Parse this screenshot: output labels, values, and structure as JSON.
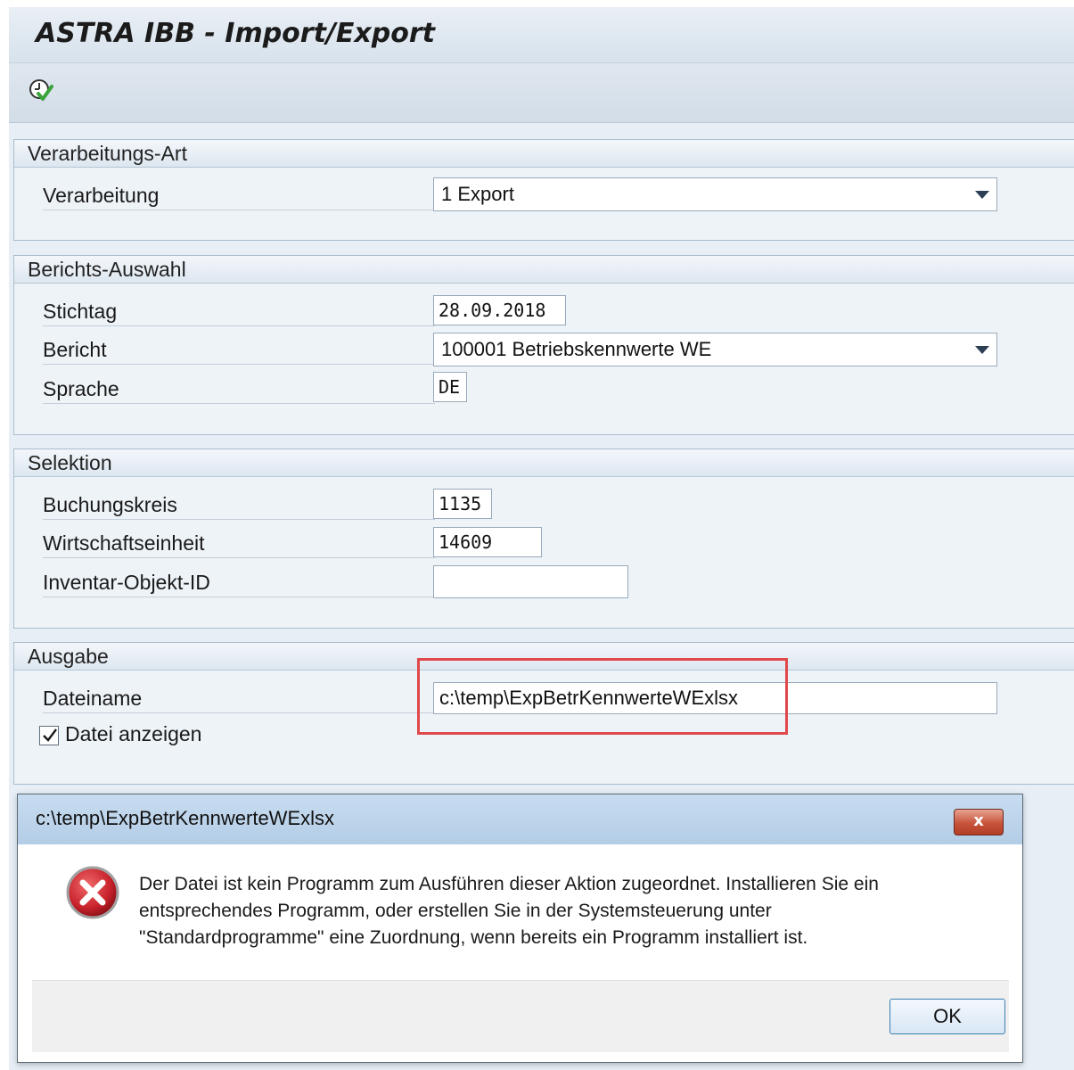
{
  "app": {
    "title": "ASTRA IBB - Import/Export"
  },
  "toolbar": {
    "execute_icon": "execute-clock-check-icon"
  },
  "processing": {
    "title": "Verarbeitungs-Art",
    "label": "Verarbeitung",
    "value": "1 Export"
  },
  "report": {
    "title": "Berichts-Auswahl",
    "date_label": "Stichtag",
    "date_value": "28.09.2018",
    "report_label": "Bericht",
    "report_value": "100001 Betriebskennwerte WE",
    "language_label": "Sprache",
    "language_value": "DE"
  },
  "selection": {
    "title": "Selektion",
    "company_code_label": "Buchungskreis",
    "company_code_value": "1135",
    "economic_unit_label": "Wirtschaftseinheit",
    "economic_unit_value": "14609",
    "inventory_object_label": "Inventar-Objekt-ID",
    "inventory_object_value": ""
  },
  "output": {
    "title": "Ausgabe",
    "filename_label": "Dateiname",
    "filename_value": "c:\\temp\\ExpBetrKennwerteWExlsx",
    "show_file_label": "Datei anzeigen",
    "show_file_checked": true
  },
  "dialog": {
    "title": "c:\\temp\\ExpBetrKennwerteWExlsx",
    "close_label": "x",
    "message_line1": "Der Datei ist kein Programm zum Ausführen dieser Aktion zugeordnet. Installieren Sie ein",
    "message_line2": "entsprechendes Programm, oder erstellen Sie in der Systemsteuerung unter",
    "message_line3": "\"Standardprogramme\" eine Zuordnung, wenn bereits ein Programm installiert ist.",
    "ok_label": "OK",
    "icon": "error-icon"
  },
  "colors": {
    "highlight": "#e0484c",
    "error_icon": "#c8232c"
  }
}
